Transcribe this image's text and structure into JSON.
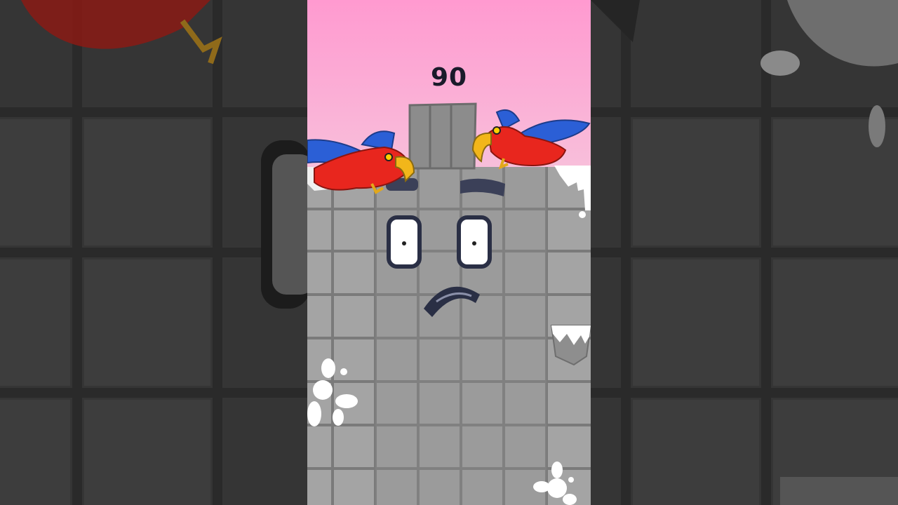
{
  "scene": {
    "counter_label": "90",
    "colors": {
      "sky_top": "#ff9fd0",
      "sky_bottom": "#f7c6de",
      "block_gray": "#9a9a9a",
      "tile_line": "#6e6e6e",
      "bird_red": "#e8261e",
      "bird_blue": "#2b5fd6",
      "beak": "#f2b61a",
      "outline": "#2a2f45"
    },
    "icons": [
      "bird-left-icon",
      "bird-right-icon",
      "paint-splat-icon",
      "paint-bucket-icon"
    ]
  }
}
